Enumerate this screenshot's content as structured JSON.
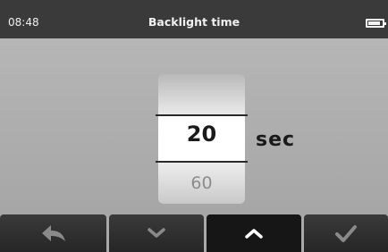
{
  "status": {
    "time": "08:48"
  },
  "header": {
    "title": "Backlight time"
  },
  "picker": {
    "current_value": "20",
    "next_value": "60",
    "unit": "sec"
  },
  "buttons": {
    "back_icon": "back-arrow-icon",
    "down_icon": "chevron-down-icon",
    "up_icon": "chevron-up-icon",
    "confirm_icon": "checkmark-icon",
    "active": "up"
  },
  "colors": {
    "header_bg": "#3a3a3a",
    "body_bg": "#a9a9a9",
    "button_bg": "#2e2e2e",
    "button_active_bg": "#161616"
  }
}
